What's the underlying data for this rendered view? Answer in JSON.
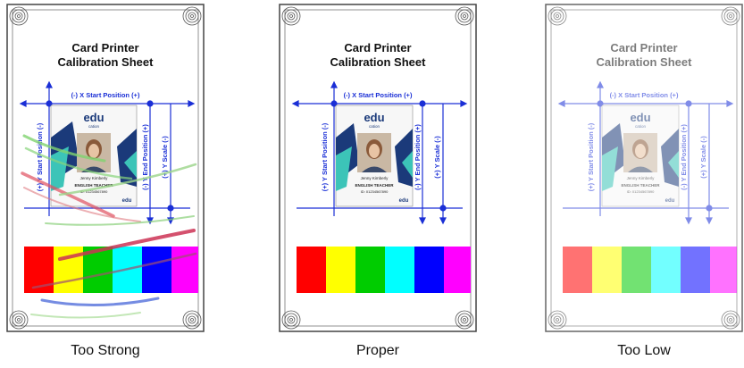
{
  "sheet": {
    "title_line1": "Card Printer",
    "title_line2": "Calibration Sheet",
    "x_start_label": "(-) X Start Position (+)",
    "y_start_label": "(+) Y Start Position (-)",
    "y_end_label": "(-) Y End Position (+)",
    "y_scale_label": "(+) Y Scale (-)",
    "card": {
      "logo_text": "edu",
      "logo_sub": "cation",
      "name": "Jenny Kimberly",
      "role": "ENGLISH TEACHER",
      "id": "ID: 01234567890",
      "small_logo": "edu"
    }
  },
  "color_bars": [
    "#ff0000",
    "#ffff00",
    "#00cc00",
    "#00ffff",
    "#0000ff",
    "#ff00ff"
  ],
  "panels": [
    {
      "caption": "Too Strong",
      "intensity": "strong"
    },
    {
      "caption": "Proper",
      "intensity": "proper"
    },
    {
      "caption": "Too Low",
      "intensity": "low"
    }
  ],
  "colors": {
    "guide_blue": "#1a2fd6",
    "title_text": "#111111",
    "frame": "#444444"
  }
}
